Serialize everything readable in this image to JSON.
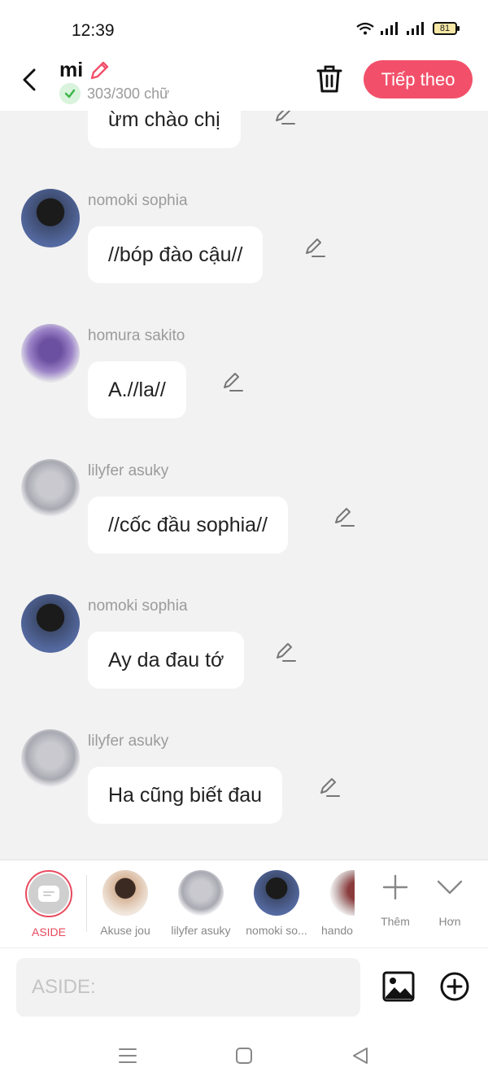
{
  "status_bar": {
    "time": "12:39",
    "battery": "81"
  },
  "header": {
    "title": "mi",
    "word_count": "303/300 chữ",
    "next_label": "Tiếp theo"
  },
  "messages": [
    {
      "sender": "",
      "text": "ừm chào chị"
    },
    {
      "sender": "nomoki sophia",
      "text": "//bóp đào cậu//"
    },
    {
      "sender": "homura sakito",
      "text": "A.//la//"
    },
    {
      "sender": "lilyfer asuky",
      "text": "//cốc đầu sophia//"
    },
    {
      "sender": "nomoki sophia",
      "text": "Ay da đau tớ"
    },
    {
      "sender": "lilyfer asuky",
      "text": "Ha cũng biết đau"
    }
  ],
  "characters": [
    {
      "label": "ASIDE"
    },
    {
      "label": "Akuse jou"
    },
    {
      "label": "lilyfer asuky"
    },
    {
      "label": "nomoki so..."
    },
    {
      "label": "hando"
    }
  ],
  "actions": {
    "add_label": "Thêm",
    "more_label": "Hơn"
  },
  "composer": {
    "placeholder": "ASIDE:"
  },
  "colors": {
    "accent": "#f2506a",
    "aside_ring": "#e84a5e",
    "background": "#f2f2f2"
  }
}
